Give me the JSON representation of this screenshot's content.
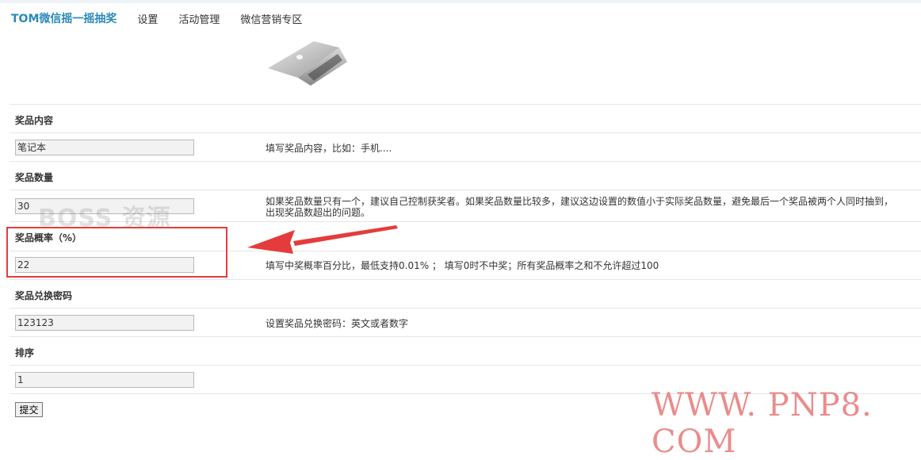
{
  "nav": {
    "brand": "TOM微信摇一摇抽奖",
    "items": [
      "设置",
      "活动管理",
      "微信营销专区"
    ]
  },
  "image": {
    "icon": "laptop-image"
  },
  "form": {
    "content": {
      "label": "奖品内容",
      "value": "笔记本",
      "help": "填写奖品内容，比如：手机...."
    },
    "quantity": {
      "label": "奖品数量",
      "value": "30",
      "help": "如果奖品数量只有一个，建议自己控制获奖者。如果奖品数量比较多，建议这边设置的数值小于实际奖品数量，避免最后一个奖品被两个人同时抽到，出现奖品数超出的问题。"
    },
    "probability": {
      "label": "奖品概率（%）",
      "value": "22",
      "help": "填写中奖概率百分比，最低支持0.01% ； 填写0时不中奖；所有奖品概率之和不允许超过100"
    },
    "password": {
      "label": "奖品兑换密码",
      "value": "123123",
      "help": "设置奖品兑换密码：英文或者数字"
    },
    "order": {
      "label": "排序",
      "value": "1"
    },
    "submit_label": "提交"
  },
  "annotation": {
    "color": "#e43c3c"
  },
  "watermarks": {
    "boss": "BOSS 资源",
    "site": "WWW. PNP8. COM"
  }
}
